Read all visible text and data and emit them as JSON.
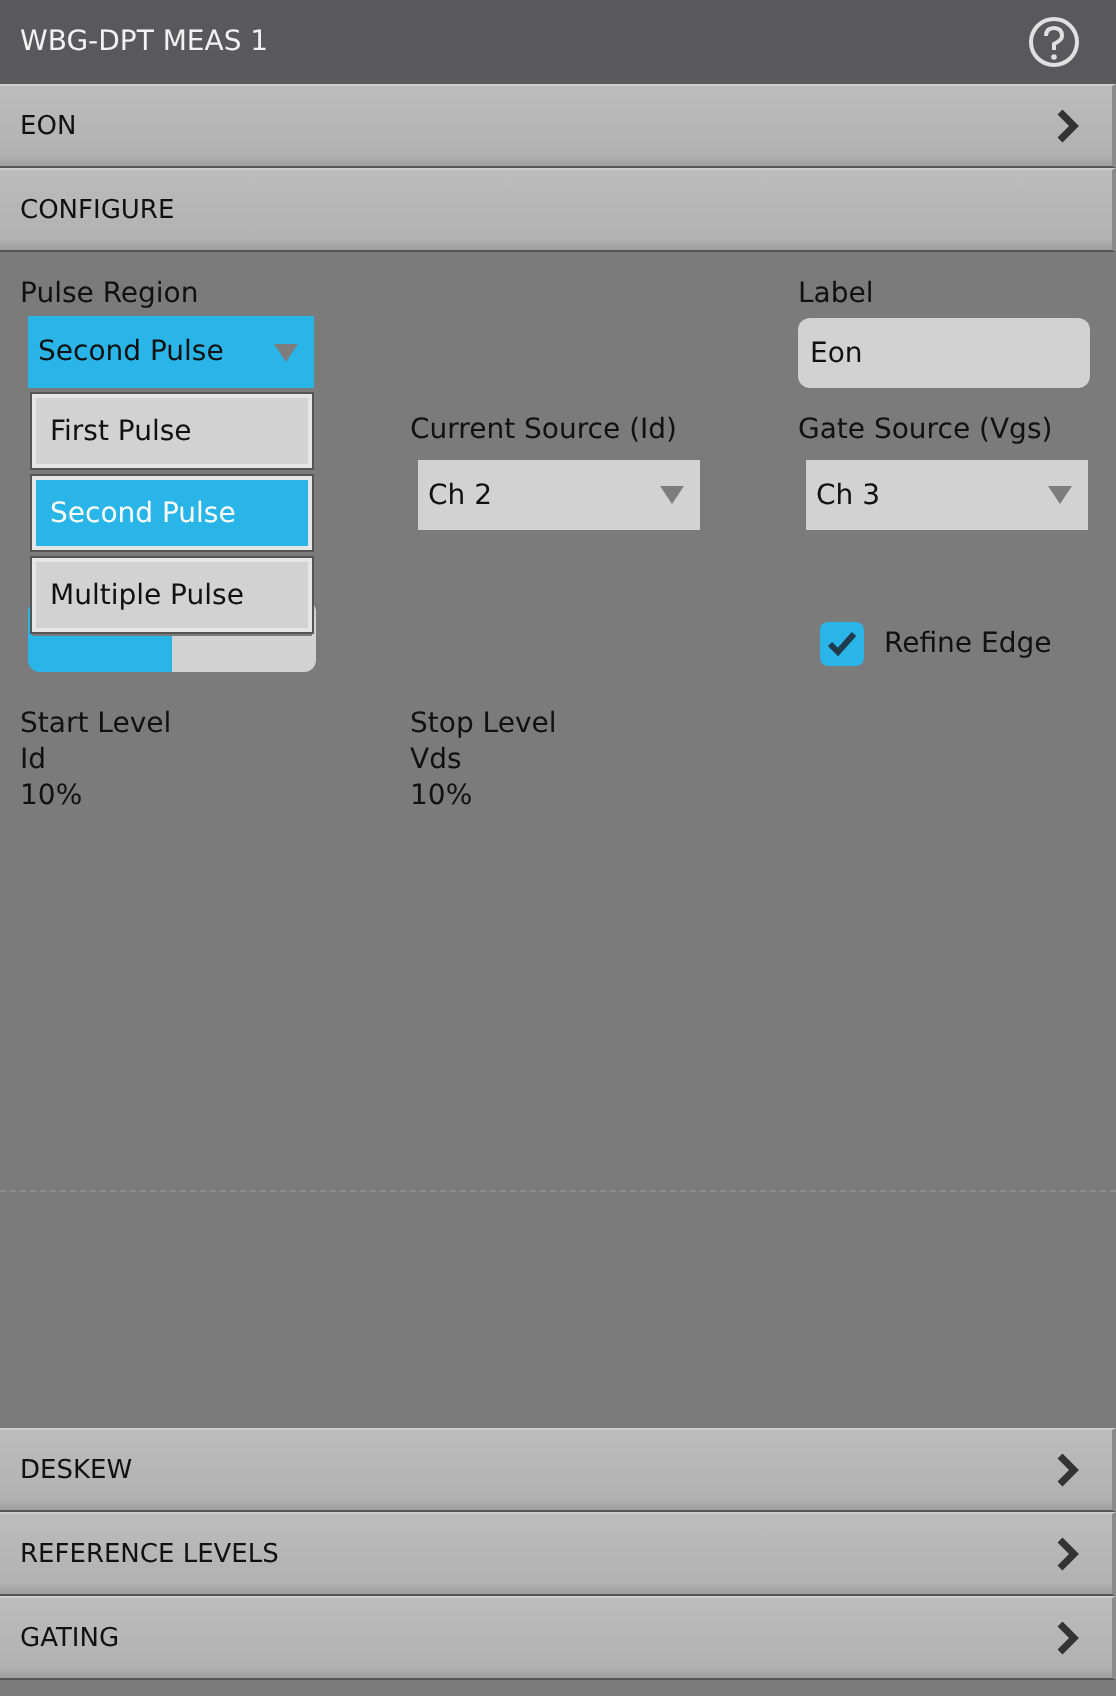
{
  "title": "WBG-DPT MEAS 1",
  "sections_top": [
    {
      "label": "EON",
      "expanded": false
    },
    {
      "label": "CONFIGURE",
      "expanded": true
    }
  ],
  "configure": {
    "pulse_region": {
      "label": "Pulse Region",
      "value": "Second Pulse",
      "open": true,
      "options": [
        {
          "label": "First Pulse",
          "selected": false
        },
        {
          "label": "Second Pulse",
          "selected": true
        },
        {
          "label": "Multiple Pulse",
          "selected": false
        }
      ]
    },
    "label_field": {
      "label": "Label",
      "value": "Eon"
    },
    "current_source": {
      "label": "Current Source (Id)",
      "value": "Ch 2"
    },
    "gate_source": {
      "label": "Gate Source (Vgs)",
      "value": "Ch 3"
    },
    "levels_mode": {
      "options": [
        {
          "selected": true
        },
        {
          "selected": false
        }
      ]
    },
    "refine_edge": {
      "label": "Refine Edge",
      "checked": true
    },
    "start_level": {
      "label": "Start Level",
      "source": "Id",
      "value": "10%"
    },
    "stop_level": {
      "label": "Stop Level",
      "source": "Vds",
      "value": "10%"
    }
  },
  "sections_bottom": [
    {
      "label": "DESKEW",
      "expanded": false
    },
    {
      "label": "REFERENCE LEVELS",
      "expanded": false
    },
    {
      "label": "GATING",
      "expanded": false
    }
  ]
}
